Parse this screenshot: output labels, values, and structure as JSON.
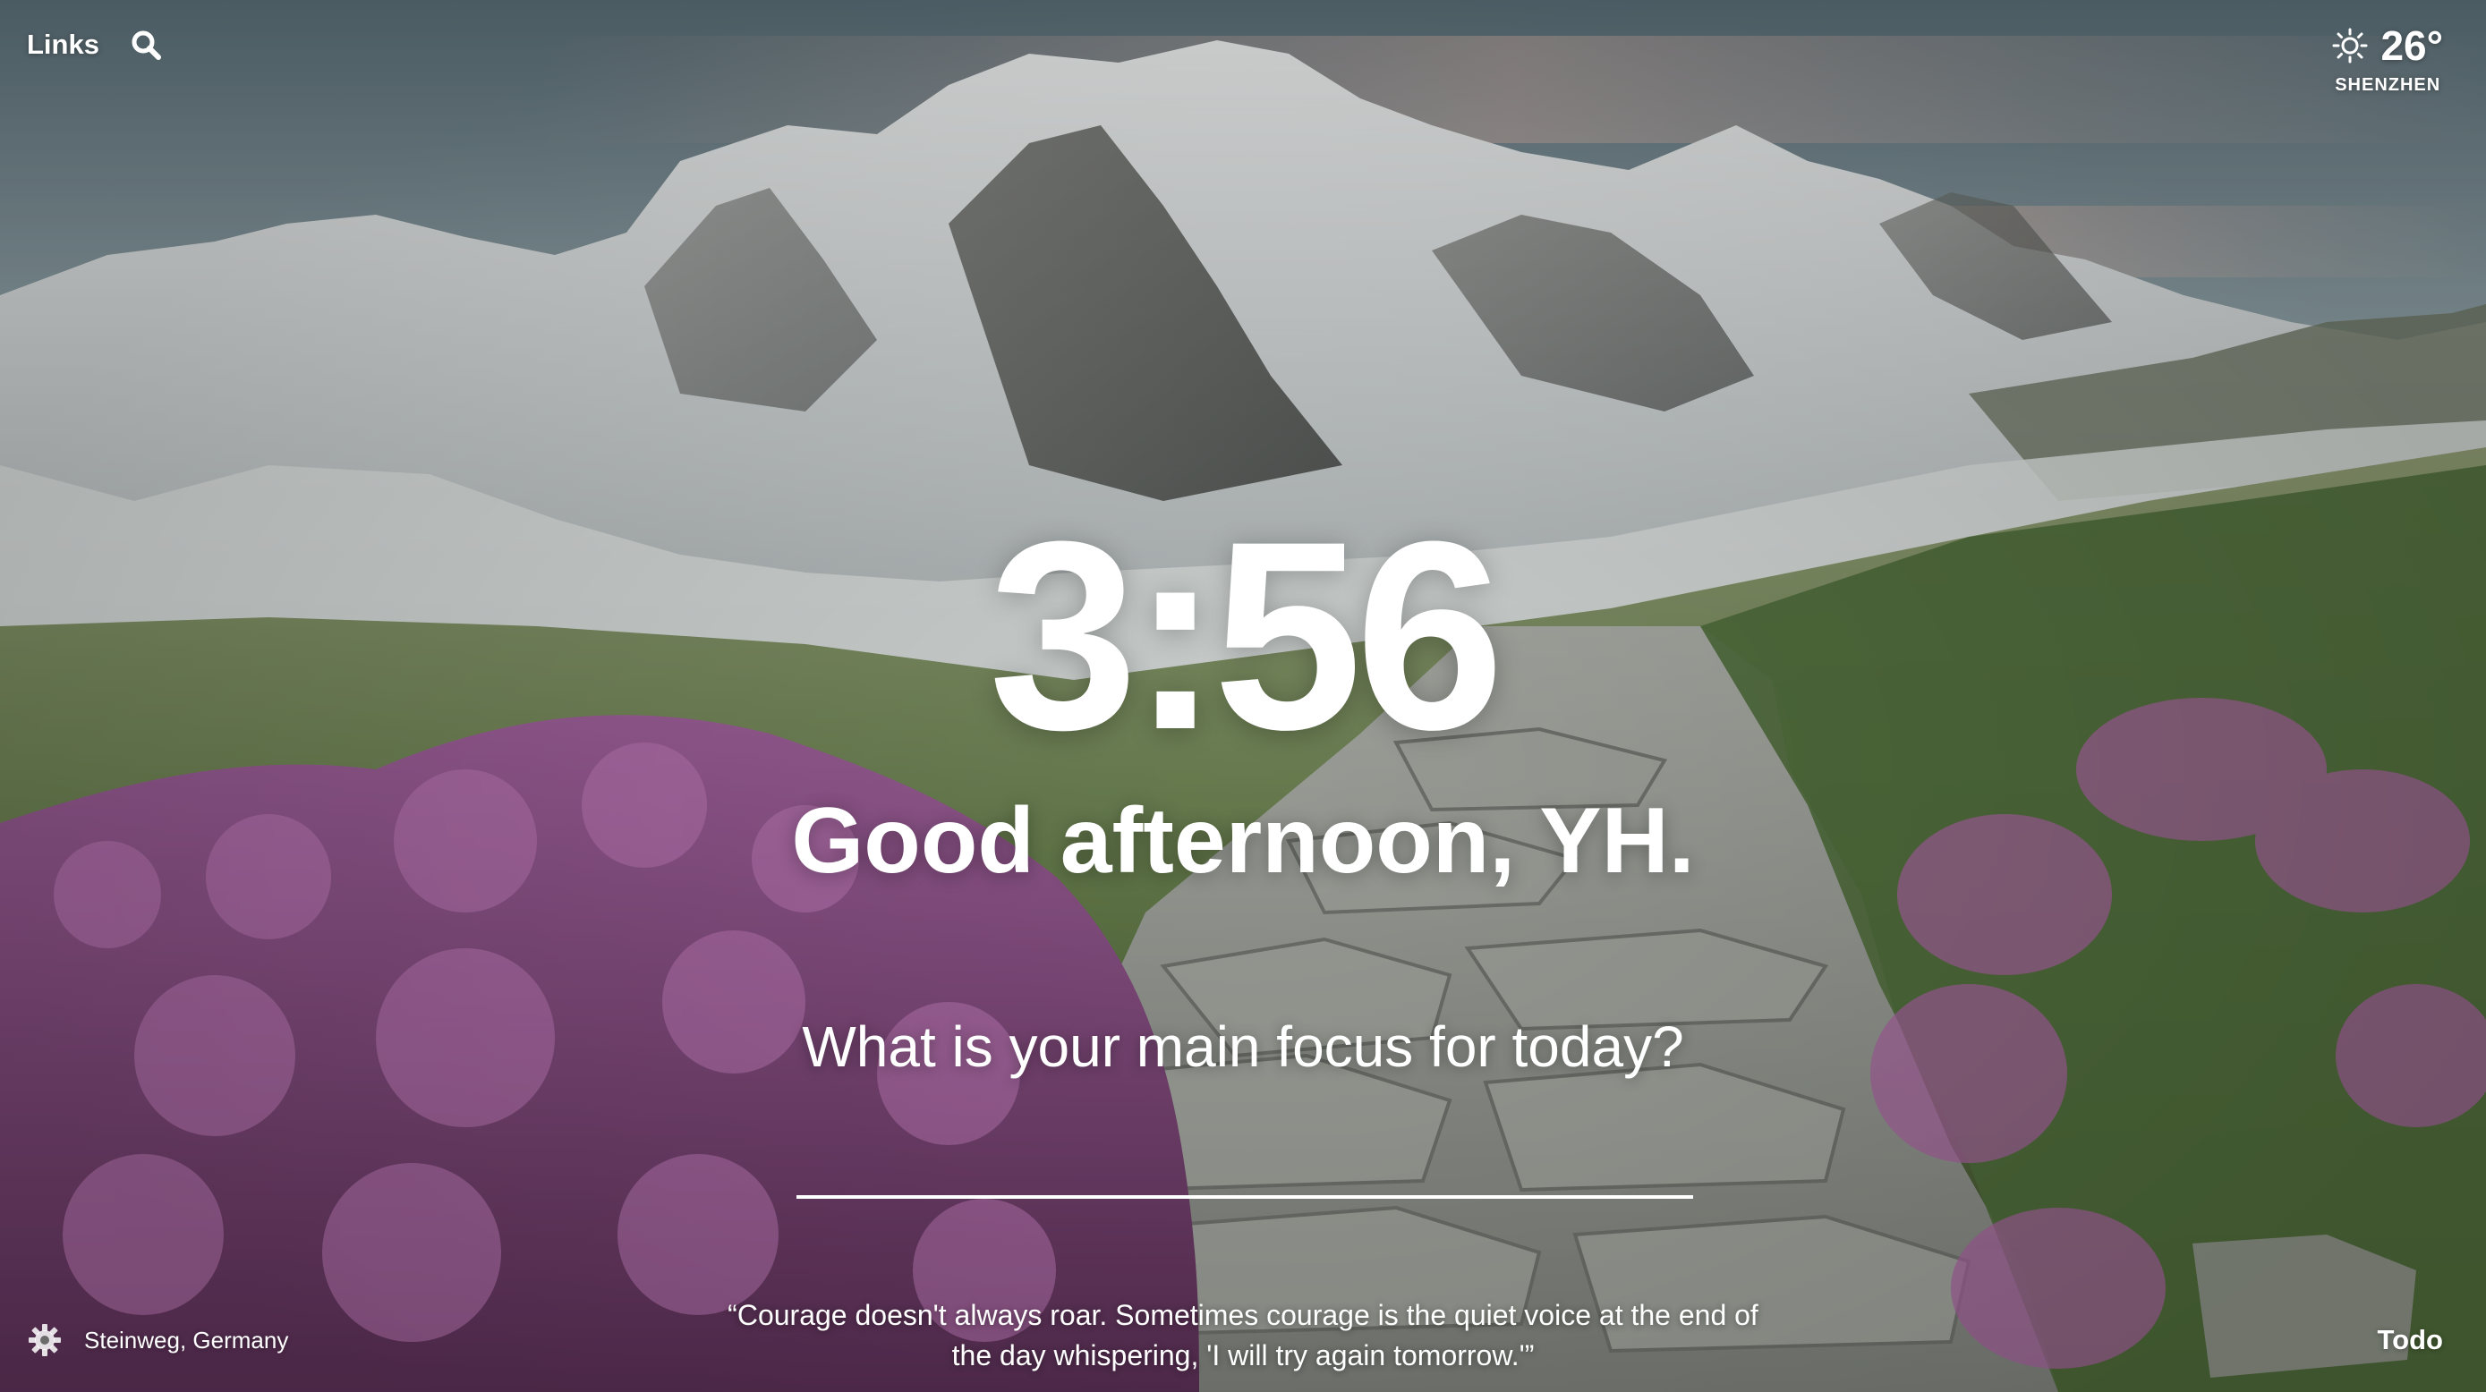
{
  "header": {
    "links_label": "Links",
    "search_icon": "search-icon"
  },
  "weather": {
    "icon": "sun-icon",
    "temperature": "26°",
    "location": "SHENZHEN"
  },
  "main": {
    "time": "3:56",
    "greeting": "Good afternoon, YH.",
    "focus_question": "What is your main focus for today?",
    "focus_value": ""
  },
  "footer": {
    "settings_icon": "gear-icon",
    "photo_location": "Steinweg, Germany",
    "quote": "“Courage doesn't always roar. Sometimes courage is the quiet voice at the end of the day whispering, 'I will try again tomorrow.'”",
    "todo_label": "Todo"
  }
}
